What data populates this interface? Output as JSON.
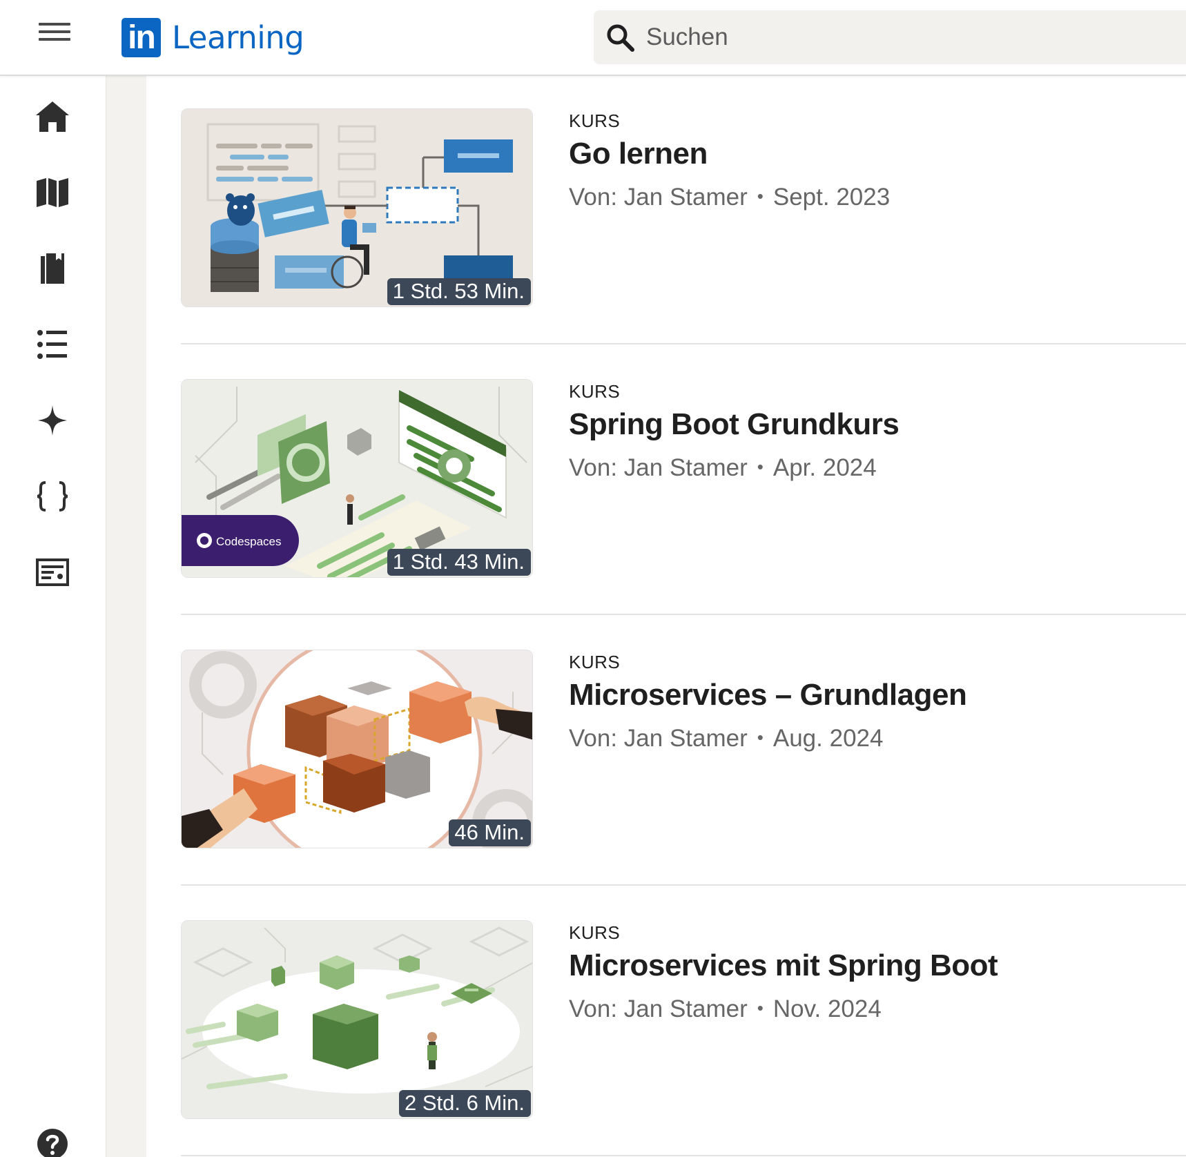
{
  "header": {
    "logo_badge": "in",
    "logo_text": "Learning",
    "search_placeholder": "Suchen"
  },
  "rail": {
    "items": [
      "home-icon",
      "map-icon",
      "library-icon",
      "list-icon",
      "sparkle-icon",
      "code-braces-icon",
      "certificate-icon"
    ],
    "help_icon": "help-icon"
  },
  "colors": {
    "brand": "#0a66c2",
    "duration_badge": "#3c4858",
    "gutter": "#f3f2ef"
  },
  "courses": [
    {
      "kind": "KURS",
      "title": "Go lernen",
      "author": "Von: Jan Stamer",
      "separator": "•",
      "date": "Sept. 2023",
      "duration": "1 Std. 53 Min."
    },
    {
      "kind": "KURS",
      "title": "Spring Boot Grundkurs",
      "author": "Von: Jan Stamer",
      "separator": "•",
      "date": "Apr. 2024",
      "duration": "1 Std. 43 Min.",
      "thumb_badge": "Codespaces"
    },
    {
      "kind": "KURS",
      "title": "Microservices – Grundlagen",
      "author": "Von: Jan Stamer",
      "separator": "•",
      "date": "Aug. 2024",
      "duration": "46 Min."
    },
    {
      "kind": "KURS",
      "title": "Microservices mit Spring Boot",
      "author": "Von: Jan Stamer",
      "separator": "•",
      "date": "Nov. 2024",
      "duration": "2 Std. 6 Min."
    }
  ]
}
